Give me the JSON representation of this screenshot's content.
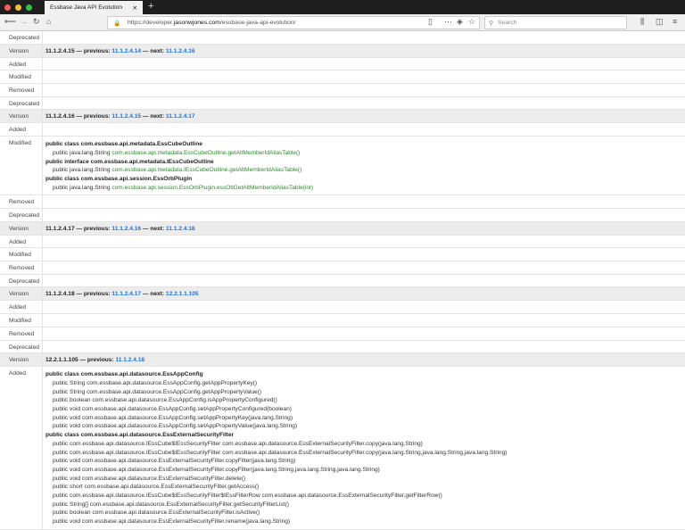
{
  "browser": {
    "tab_title": "Essbase Java API Evolution",
    "url_prefix": "https://developer.",
    "url_domain": "jasonwjones.com",
    "url_path": "/essbase-java-api-evolution/",
    "search_placeholder": "Search"
  },
  "sections": [
    {
      "rows": [
        {
          "label": "Deprecated",
          "classes": []
        }
      ]
    },
    {
      "version": "11.1.2.4.15",
      "previous": "11.1.2.4.14",
      "next": "11.1.2.4.16",
      "rows": [
        {
          "label": "Added",
          "classes": []
        },
        {
          "label": "Modified",
          "classes": []
        },
        {
          "label": "Removed",
          "classes": []
        },
        {
          "label": "Deprecated",
          "classes": []
        }
      ]
    },
    {
      "version": "11.1.2.4.16",
      "previous": "11.1.2.4.15",
      "next": "11.1.2.4.17",
      "rows": [
        {
          "label": "Added",
          "classes": []
        },
        {
          "label": "Modified",
          "classes": [
            {
              "name": "public class com.essbase.api.metadata.EssCubeOutline",
              "members": [
                {
                  "pre": "public java.lang.String ",
                  "sig": "com.essbase.api.metadata.EssCubeOutline.getAltMemberIdAliasTable()",
                  "green": true
                }
              ]
            },
            {
              "name": "public interface com.essbase.api.metadata.IEssCubeOutline",
              "members": [
                {
                  "pre": "public java.lang.String ",
                  "sig": "com.essbase.api.metadata.IEssCubeOutline.getAltMemberIdAliasTable()",
                  "green": true
                }
              ]
            },
            {
              "name": "public class com.essbase.api.session.EssOrbPlugin",
              "members": [
                {
                  "pre": "public java.lang.String ",
                  "sig": "com.essbase.api.session.EssOrbPlugin.essOtlGetAltMemberIdAliasTable(int)",
                  "green": true
                }
              ]
            }
          ]
        },
        {
          "label": "Removed",
          "classes": []
        },
        {
          "label": "Deprecated",
          "classes": []
        }
      ]
    },
    {
      "version": "11.1.2.4.17",
      "previous": "11.1.2.4.16",
      "next": "11.1.2.4.18",
      "rows": [
        {
          "label": "Added",
          "classes": []
        },
        {
          "label": "Modified",
          "classes": []
        },
        {
          "label": "Removed",
          "classes": []
        },
        {
          "label": "Deprecated",
          "classes": []
        }
      ]
    },
    {
      "version": "11.1.2.4.18",
      "previous": "11.1.2.4.17",
      "next": "12.2.1.1.105",
      "rows": [
        {
          "label": "Added",
          "classes": []
        },
        {
          "label": "Modified",
          "classes": []
        },
        {
          "label": "Removed",
          "classes": []
        },
        {
          "label": "Deprecated",
          "classes": []
        }
      ]
    },
    {
      "version": "12.2.1.1.105",
      "previous": "11.1.2.4.18",
      "rows": [
        {
          "label": "Added",
          "classes": [
            {
              "name": "public class com.essbase.api.datasource.EssAppConfig",
              "members": [
                {
                  "pre": "",
                  "sig": "public String com.essbase.api.datasource.EssAppConfig.getAppPropertyKey()"
                },
                {
                  "pre": "",
                  "sig": "public String com.essbase.api.datasource.EssAppConfig.getAppPropertyValue()"
                },
                {
                  "pre": "",
                  "sig": "public boolean com.essbase.api.datasource.EssAppConfig.isAppPropertyConfigured()"
                },
                {
                  "pre": "",
                  "sig": "public void com.essbase.api.datasource.EssAppConfig.setAppPropertyConfigured(boolean)"
                },
                {
                  "pre": "",
                  "sig": "public void com.essbase.api.datasource.EssAppConfig.setAppPropertyKey(java.lang.String)"
                },
                {
                  "pre": "",
                  "sig": "public void com.essbase.api.datasource.EssAppConfig.setAppPropertyValue(java.lang.String)"
                }
              ]
            },
            {
              "name": "public class com.essbase.api.datasource.EssExternalSecurityFilter",
              "members": [
                {
                  "pre": "",
                  "sig": "public com.essbase.api.datasource.IEssCube$IEssSecurityFilter com.essbase.api.datasource.EssExternalSecurityFilter.copy(java.lang.String)"
                },
                {
                  "pre": "",
                  "sig": "public com.essbase.api.datasource.IEssCube$IEssSecurityFilter com.essbase.api.datasource.EssExternalSecurityFilter.copy(java.lang.String,java.lang.String,java.lang.String)"
                },
                {
                  "pre": "",
                  "sig": "public void com.essbase.api.datasource.EssExternalSecurityFilter.copyFilter(java.lang.String)"
                },
                {
                  "pre": "",
                  "sig": "public void com.essbase.api.datasource.EssExternalSecurityFilter.copyFilter(java.lang.String,java.lang.String,java.lang.String)"
                },
                {
                  "pre": "",
                  "sig": "public void com.essbase.api.datasource.EssExternalSecurityFilter.delete()"
                },
                {
                  "pre": "",
                  "sig": "public short com.essbase.api.datasource.EssExternalSecurityFilter.getAccess()"
                },
                {
                  "pre": "",
                  "sig": "public com.essbase.api.datasource.IEssCube$IEssSecurityFilter$IEssFilterRow com.essbase.api.datasource.EssExternalSecurityFilter.getFilterRow()"
                },
                {
                  "pre": "",
                  "sig": "public String[] com.essbase.api.datasource.EssExternalSecurityFilter.getSecurityFilterList()"
                },
                {
                  "pre": "",
                  "sig": "public boolean com.essbase.api.datasource.EssExternalSecurityFilter.isActive()"
                },
                {
                  "pre": "",
                  "sig": "public void com.essbase.api.datasource.EssExternalSecurityFilter.rename(java.lang.String)"
                }
              ]
            }
          ]
        }
      ]
    }
  ],
  "labels": {
    "version": "Version",
    "previous": " — previous: ",
    "next": " — next: "
  }
}
